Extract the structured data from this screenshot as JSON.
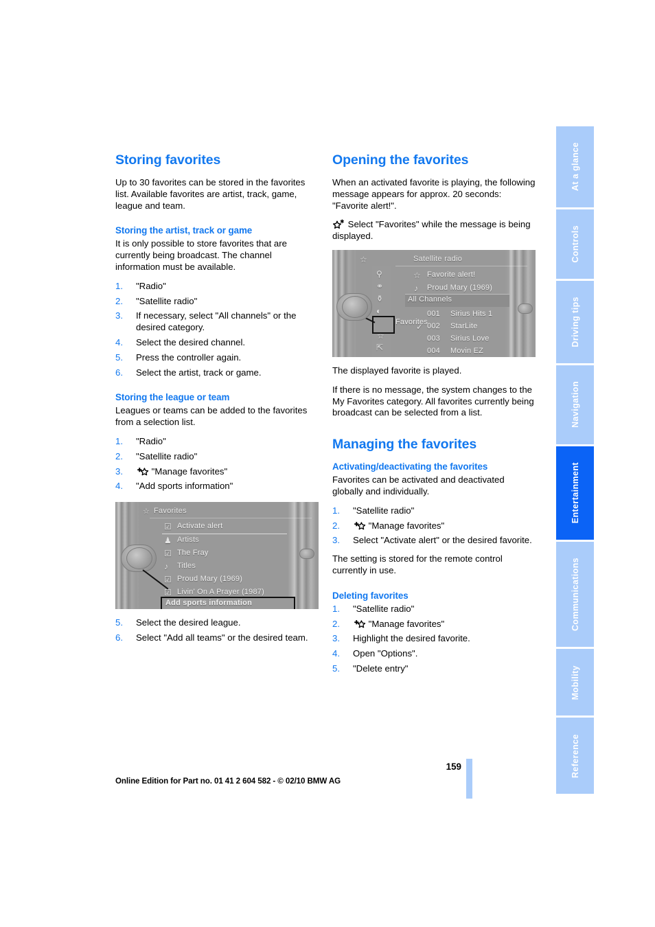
{
  "document": {
    "page_number": "159",
    "edition_line": "Online Edition for Part no. 01 41 2 604 582 - © 02/10 BMW AG",
    "accent_blue": "#1278ef",
    "tab_blue": "#aaccfa",
    "tab_active_blue": "#0b63f6"
  },
  "sidebar": {
    "tabs": [
      {
        "label": "At a glance",
        "active": false
      },
      {
        "label": "Controls",
        "active": false
      },
      {
        "label": "Driving tips",
        "active": false
      },
      {
        "label": "Navigation",
        "active": false
      },
      {
        "label": "Entertainment",
        "active": true
      },
      {
        "label": "Communications",
        "active": false
      },
      {
        "label": "Mobility",
        "active": false
      },
      {
        "label": "Reference",
        "active": false
      }
    ]
  },
  "left_column": {
    "heading": "Storing favorites",
    "intro": "Up to 30 favorites can be stored in the favorites list. Available favorites are artist, track, game, league and team.",
    "section_artist": {
      "heading": "Storing the artist, track or game",
      "intro": "It is only possible to store favorites that are currently being broadcast. The channel information must be available.",
      "steps": [
        {
          "num": "1.",
          "text": "\"Radio\""
        },
        {
          "num": "2.",
          "text": "\"Satellite radio\""
        },
        {
          "num": "3.",
          "text": "If necessary, select \"All channels\" or the desired category."
        },
        {
          "num": "4.",
          "text": "Select the desired channel."
        },
        {
          "num": "5.",
          "text": "Press the controller again."
        },
        {
          "num": "6.",
          "text": "Select the artist, track or game."
        }
      ]
    },
    "section_league": {
      "heading": "Storing the league or team",
      "intro": "Leagues or teams can be added to the favorites from a selection list.",
      "steps": [
        {
          "num": "1.",
          "text": "\"Radio\"",
          "icon": null
        },
        {
          "num": "2.",
          "text": "\"Satellite radio\"",
          "icon": null
        },
        {
          "num": "3.",
          "text": "\"Manage favorites\"",
          "icon": "plus-star-icon"
        },
        {
          "num": "4.",
          "text": "\"Add sports information\"",
          "icon": null
        }
      ],
      "steps_after": [
        {
          "num": "5.",
          "text": "Select the desired league."
        },
        {
          "num": "6.",
          "text": "Select \"Add all teams\" or the desired team."
        }
      ]
    },
    "favorites_screenshot": {
      "title": "Favorites",
      "rows": [
        {
          "icon": "checkbox-checked-icon",
          "label": "Activate alert"
        },
        {
          "icon": "person-icon",
          "label": "Artists"
        },
        {
          "icon": "checkbox-checked-icon",
          "label": "The Fray"
        },
        {
          "icon": "music-note-icon",
          "label": "Titles"
        },
        {
          "icon": "checkbox-checked-icon",
          "label": "Proud Mary (1969)"
        },
        {
          "icon": "checkbox-checked-icon",
          "label": "Livin' On A Prayer (1987)"
        }
      ],
      "selected_label": "Add sports information"
    }
  },
  "right_column": {
    "section_opening": {
      "heading": "Opening the favorites",
      "intro": "When an activated favorite is playing, the following message appears for approx. 20 seconds: \"Favorite alert!\".",
      "icon_step": "Select \"Favorites\" while the message is being displayed.",
      "icon_step_icon": "star-asterisk-icon",
      "after_1": "The displayed favorite is played.",
      "after_2": "If there is no message, the system changes to the My Favorites category. All favorites currently being broadcast can be selected from a list."
    },
    "satellite_screenshot": {
      "title": "Satellite radio",
      "info_rows": [
        {
          "icon": "star-icon",
          "label": "Favorite alert!"
        },
        {
          "icon": "music-note-icon",
          "label": "Proud Mary (1969)"
        }
      ],
      "category_row": "All Channels",
      "channels": [
        {
          "number": "001",
          "name": "Sirius Hits 1",
          "checked": false
        },
        {
          "number": "002",
          "name": "StarLite",
          "checked": true
        },
        {
          "number": "003",
          "name": "Sirius Love",
          "checked": false
        },
        {
          "number": "004",
          "name": "Movin EZ",
          "checked": false
        }
      ],
      "callout_label": "Favorites",
      "menu_icons": [
        "search-icon",
        "browse-icon",
        "category-icon",
        "tone-icon",
        "favorites-add-icon",
        "favorites-icon",
        "back-icon"
      ]
    },
    "section_managing": {
      "heading": "Managing the favorites",
      "activating": {
        "heading": "Activating/deactivating the favorites",
        "intro": "Favorites can be activated and deactivated globally and individually.",
        "steps": [
          {
            "num": "1.",
            "text": "\"Satellite radio\"",
            "icon": null
          },
          {
            "num": "2.",
            "text": "\"Manage favorites\"",
            "icon": "plus-star-icon"
          },
          {
            "num": "3.",
            "text": "Select \"Activate alert\" or the desired favorite.",
            "icon": null
          }
        ],
        "note": "The setting is stored for the remote control currently in use."
      },
      "deleting": {
        "heading": "Deleting favorites",
        "steps": [
          {
            "num": "1.",
            "text": "\"Satellite radio\"",
            "icon": null
          },
          {
            "num": "2.",
            "text": "\"Manage favorites\"",
            "icon": "plus-star-icon"
          },
          {
            "num": "3.",
            "text": "Highlight the desired favorite.",
            "icon": null
          },
          {
            "num": "4.",
            "text": "Open \"Options\".",
            "icon": null
          },
          {
            "num": "5.",
            "text": "\"Delete entry\"",
            "icon": null
          }
        ]
      }
    }
  }
}
